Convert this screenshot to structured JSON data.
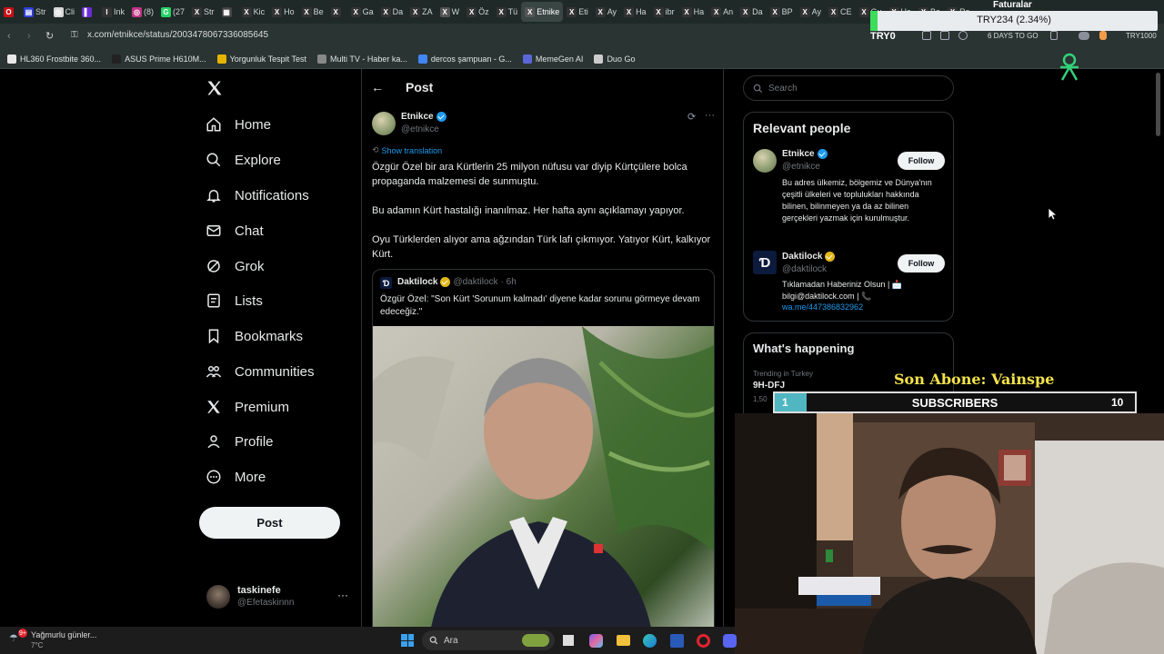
{
  "browser": {
    "tabs": [
      {
        "label": "",
        "color": "#cc0f16",
        "glyph": "O"
      },
      {
        "label": "Str",
        "color": "#2c3ed8",
        "glyph": "▤"
      },
      {
        "label": "Cli",
        "color": "#d8d8d8",
        "glyph": "◎"
      },
      {
        "label": "",
        "color": "#6c2bd9",
        "glyph": "▌"
      },
      {
        "label": "Ink",
        "color": "#333",
        "glyph": "I"
      },
      {
        "label": "(8)",
        "color": "#c13584",
        "glyph": "◎"
      },
      {
        "label": "(27",
        "color": "#25d366",
        "glyph": "G"
      },
      {
        "label": "Str",
        "color": "#333",
        "glyph": "X"
      },
      {
        "label": "",
        "color": "#444",
        "glyph": "▦"
      },
      {
        "label": "Kic",
        "color": "#333",
        "glyph": "X"
      },
      {
        "label": "Ho",
        "color": "#333",
        "glyph": "X"
      },
      {
        "label": "Be",
        "color": "#333",
        "glyph": "X"
      },
      {
        "label": "",
        "color": "#333",
        "glyph": "X"
      },
      {
        "label": "Ga",
        "color": "#333",
        "glyph": "X"
      },
      {
        "label": "Da",
        "color": "#333",
        "glyph": "X"
      },
      {
        "label": "ZA",
        "color": "#333",
        "glyph": "X"
      },
      {
        "label": "W",
        "color": "#555",
        "glyph": "X"
      },
      {
        "label": "Öz",
        "color": "#333",
        "glyph": "X"
      },
      {
        "label": "Tü",
        "color": "#333",
        "glyph": "X"
      },
      {
        "label": "Etnike",
        "color": "#555",
        "glyph": "X",
        "active": true
      },
      {
        "label": "Eti",
        "color": "#333",
        "glyph": "X"
      },
      {
        "label": "Ay",
        "color": "#333",
        "glyph": "X"
      },
      {
        "label": "Ha",
        "color": "#333",
        "glyph": "X"
      },
      {
        "label": "ibr",
        "color": "#333",
        "glyph": "X"
      },
      {
        "label": "Ha",
        "color": "#333",
        "glyph": "X"
      },
      {
        "label": "An",
        "color": "#333",
        "glyph": "X"
      },
      {
        "label": "Da",
        "color": "#333",
        "glyph": "X"
      },
      {
        "label": "BP",
        "color": "#333",
        "glyph": "X"
      },
      {
        "label": "Ay",
        "color": "#333",
        "glyph": "X"
      },
      {
        "label": "CE",
        "color": "#333",
        "glyph": "X"
      },
      {
        "label": "Gu",
        "color": "#333",
        "glyph": "X"
      },
      {
        "label": "Ha",
        "color": "#333",
        "glyph": "X"
      },
      {
        "label": "Bo",
        "color": "#333",
        "glyph": "X"
      },
      {
        "label": "Ra",
        "color": "#333",
        "glyph": "X"
      }
    ],
    "url": "x.com/etnikce/status/2003478067336085645",
    "bookmarks": [
      {
        "label": "HL360 Frostbite 360...",
        "color": "#e8e8e8"
      },
      {
        "label": "ASUS Prime H610M...",
        "color": "#222"
      },
      {
        "label": "Yorgunluk Tespit Test",
        "color": "#e6b400"
      },
      {
        "label": "Multi TV - Haber ka...",
        "color": "#888"
      },
      {
        "label": "dercos şampuan - G...",
        "color": "#4285f4"
      },
      {
        "label": "MemeGen AI",
        "color": "#5a67d8"
      },
      {
        "label": "Duo Go",
        "color": "#ccc"
      }
    ],
    "extension_text": "6 DAYS TO GO",
    "extension_short": "TRY1000"
  },
  "overlay": {
    "price_title": "Faturalar",
    "price_value": "TRY234 (2.34%)",
    "price_label": "TRY0",
    "sub_last_label": "Son Abone: Vainspe",
    "sub_count": "1",
    "sub_title": "SUBSCRIBERS",
    "sub_goal": "10"
  },
  "nav": {
    "items": [
      {
        "label": "Home",
        "icon": "home-icon"
      },
      {
        "label": "Explore",
        "icon": "search-icon"
      },
      {
        "label": "Notifications",
        "icon": "bell-icon"
      },
      {
        "label": "Chat",
        "icon": "mail-icon"
      },
      {
        "label": "Grok",
        "icon": "grok-icon"
      },
      {
        "label": "Lists",
        "icon": "list-icon"
      },
      {
        "label": "Bookmarks",
        "icon": "bookmark-icon"
      },
      {
        "label": "Communities",
        "icon": "people-icon"
      },
      {
        "label": "Premium",
        "icon": "x-logo-icon"
      },
      {
        "label": "Profile",
        "icon": "person-icon"
      },
      {
        "label": "More",
        "icon": "more-circle-icon"
      }
    ],
    "post_label": "Post",
    "account": {
      "name": "taskinefe",
      "handle": "@Efetaskinnn"
    }
  },
  "post": {
    "header": "Post",
    "author_name": "Etnikce",
    "author_handle": "@etnikce",
    "show_translation": "Show translation",
    "paragraphs": [
      "Özgür Özel bir ara Kürtlerin 25 milyon nüfusu var diyip Kürtçülere bolca propaganda malzemesi de sunmuştu.",
      "Bu adamın Kürt hastalığı inanılmaz. Her hafta aynı açıklamayı yapıyor.",
      "Oyu Türklerden alıyor ama ağzından Türk lafı çıkmıyor. Yatıyor Kürt, kalkıyor Kürt."
    ],
    "quote": {
      "name": "Daktilock",
      "handle": "@daktilock",
      "time": "· 6h",
      "text": "Özgür Özel: \"Son Kürt 'Sorunum kalmadı' diyene kadar sorunu görmeye devam edeceğiz.\""
    }
  },
  "sidebar": {
    "search_placeholder": "Search",
    "relevant_title": "Relevant people",
    "people": [
      {
        "name": "Etnikce",
        "handle": "@etnikce",
        "follow": "Follow",
        "bio": "Bu adres ülkemiz, bölgemiz ve Dünya'nın çeşitli ülkeleri ve toplulukları hakkında bilinen, bilinmeyen ya da az bilinen gerçekleri yazmak için kurulmuştur."
      },
      {
        "name": "Daktilock",
        "handle": "@daktilock",
        "follow": "Follow",
        "bio": "Tıklamadan Haberiniz Olsun | 📩 bilgi@daktilock.com | 📞",
        "link": "wa.me/447386832962"
      }
    ],
    "happening_title": "What's happening",
    "trend_context": "Trending in Turkey",
    "trend_name": "9H-DFJ",
    "trend_count": "1,50"
  },
  "taskbar": {
    "weather_title": "Yağmurlu günler...",
    "weather_temp": "7°C",
    "weather_badge": "9+",
    "search_label": "Ara"
  }
}
